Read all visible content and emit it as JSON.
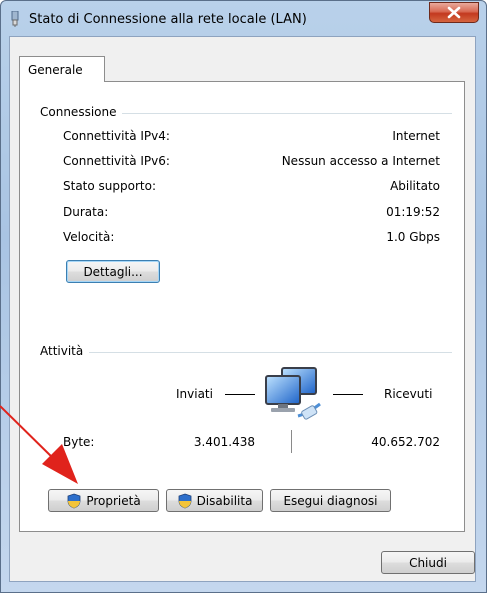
{
  "window": {
    "title": "Stato di Connessione alla rete locale (LAN)",
    "close_label": "X"
  },
  "tabs": [
    {
      "label": "Generale",
      "active": true
    }
  ],
  "connection": {
    "heading": "Connessione",
    "rows": [
      {
        "label": "Connettività IPv4:",
        "value": "Internet"
      },
      {
        "label": "Connettività IPv6:",
        "value": "Nessun accesso a Internet"
      },
      {
        "label": "Stato supporto:",
        "value": "Abilitato"
      },
      {
        "label": "Durata:",
        "value": "01:19:52"
      },
      {
        "label": "Velocità:",
        "value": "1.0 Gbps"
      }
    ],
    "details_button": "Dettagli..."
  },
  "activity": {
    "heading": "Attività",
    "sent_label": "Inviati",
    "received_label": "Ricevuti",
    "bytes_label": "Byte:",
    "bytes_sent": "3.401.438",
    "bytes_received": "40.652.702"
  },
  "buttons": {
    "properties": "Proprietà",
    "disable": "Disabilita",
    "diagnose": "Esegui diagnosi",
    "close": "Chiudi"
  },
  "colors": {
    "annotation_arrow": "#e0231c",
    "close_button": "#c3391f"
  }
}
